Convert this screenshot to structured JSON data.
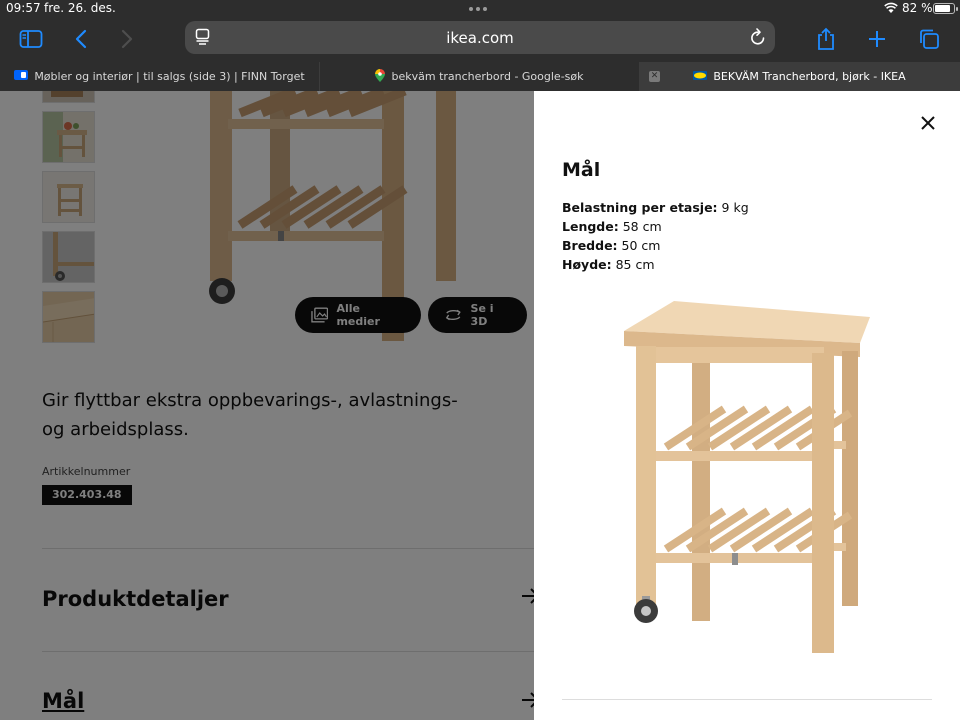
{
  "status_bar": {
    "time": "09:57",
    "date": "fre. 26. des.",
    "battery_percent": "82 %",
    "battery_level": 0.82
  },
  "browser": {
    "url": "ikea.com",
    "tabs": [
      {
        "label": "Møbler og interiør | til salgs (side 3) | FINN Torget",
        "active": false
      },
      {
        "label": "bekväm trancherbord - Google-søk",
        "active": false
      },
      {
        "label": "BEKVÄM Trancherbord, bjørk - IKEA",
        "active": true
      }
    ]
  },
  "product": {
    "media_buttons": {
      "all_media": "Alle medier",
      "view_3d": "Se i 3D"
    },
    "description": "Gir flyttbar ekstra oppbevarings-, avlastnings- og arbeidsplass.",
    "article_label": "Artikkelnummer",
    "article_number": "302.403.48",
    "sections": [
      {
        "label": "Produktdetaljer"
      },
      {
        "label": "Mål"
      }
    ]
  },
  "modal": {
    "title": "Mål",
    "specs": [
      {
        "key": "Belastning per etasje:",
        "value": "9 kg"
      },
      {
        "key": "Lengde:",
        "value": "58 cm"
      },
      {
        "key": "Bredde:",
        "value": "50 cm"
      },
      {
        "key": "Høyde:",
        "value": "85 cm"
      }
    ]
  },
  "colors": {
    "browser_chrome": "#2d2d2d",
    "accent_blue": "#1f8bff",
    "wood": "#e3c7a1"
  }
}
